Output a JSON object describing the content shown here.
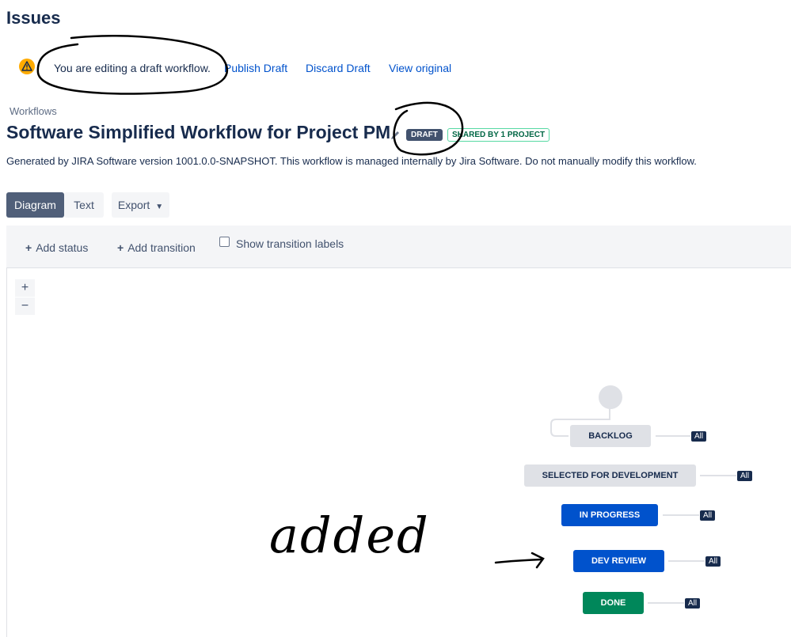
{
  "page": {
    "heading": "Issues"
  },
  "draft_banner": {
    "message": "You are editing a draft workflow.",
    "publish_link": "Publish Draft",
    "discard_link": "Discard Draft",
    "view_original_link": "View original"
  },
  "breadcrumb": "Workflows",
  "workflow": {
    "title": "Software Simplified Workflow for Project PM",
    "draft_badge": "DRAFT",
    "shared_badge": "SHARED BY 1 PROJECT",
    "description": "Generated by JIRA Software version 1001.0.0-SNAPSHOT. This workflow is managed internally by Jira Software. Do not manually modify this workflow."
  },
  "view_tabs": {
    "diagram": "Diagram",
    "text": "Text",
    "export": "Export"
  },
  "toolbar": {
    "add_status": "Add status",
    "add_transition": "Add transition",
    "show_labels": "Show transition labels"
  },
  "zoom": {
    "in": "+",
    "out": "−"
  },
  "statuses": [
    {
      "label": "BACKLOG",
      "color": "#dfe1e6"
    },
    {
      "label": "SELECTED FOR DEVELOPMENT",
      "color": "#dfe1e6"
    },
    {
      "label": "IN PROGRESS",
      "color": "#0052cc"
    },
    {
      "label": "DEV REVIEW",
      "color": "#0052cc"
    },
    {
      "label": "DONE",
      "color": "#00875a"
    }
  ],
  "all_transition_label": "All",
  "annotation": {
    "handwritten_text": "added"
  },
  "icons": {
    "warning": "warning-icon",
    "pencil": "pencil-icon",
    "plus": "plus-icon",
    "chevron": "chevron-down-icon"
  }
}
